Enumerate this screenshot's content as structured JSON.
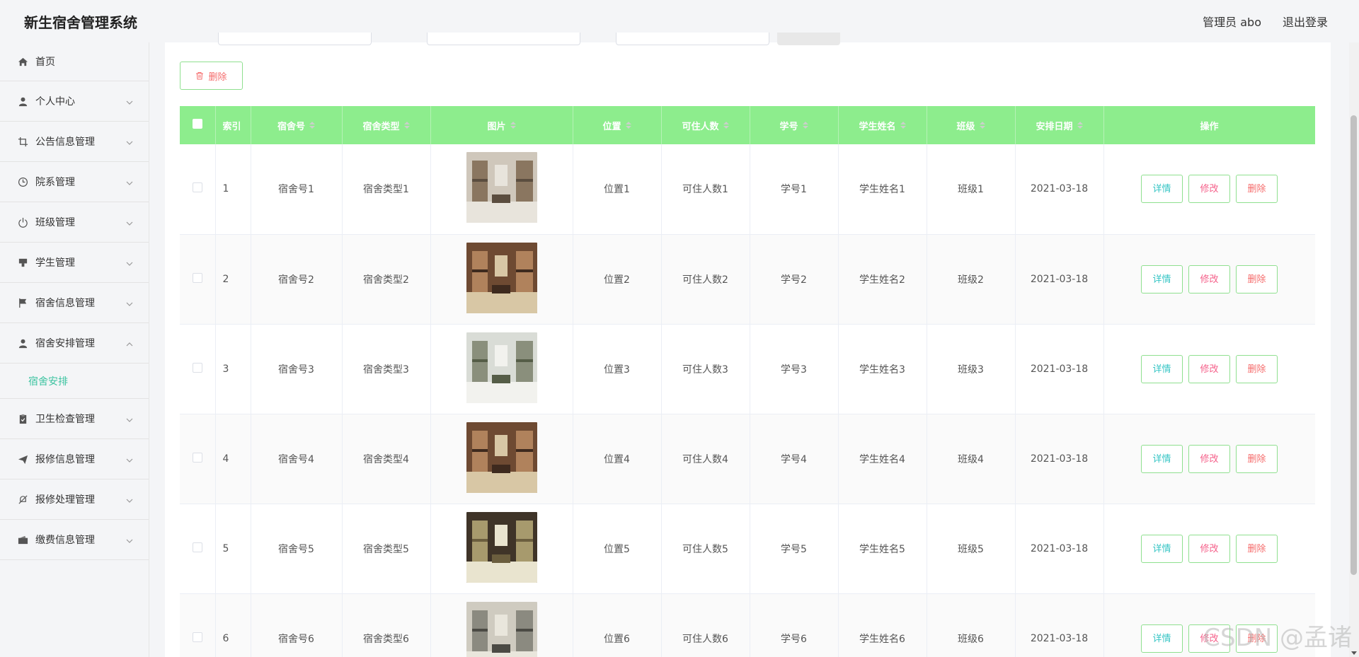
{
  "header": {
    "title": "新生宿舍管理系统",
    "user_label": "管理员 abo",
    "logout_label": "退出登录"
  },
  "sidebar": {
    "items": [
      {
        "label": "首页",
        "icon": "home-icon"
      },
      {
        "label": "个人中心",
        "icon": "user-icon"
      },
      {
        "label": "公告信息管理",
        "icon": "crop-icon"
      },
      {
        "label": "院系管理",
        "icon": "clock-icon"
      },
      {
        "label": "班级管理",
        "icon": "power-icon"
      },
      {
        "label": "学生管理",
        "icon": "stamp-icon"
      },
      {
        "label": "宿舍信息管理",
        "icon": "flag-icon"
      },
      {
        "label": "宿舍安排管理",
        "icon": "user-icon",
        "expanded": true
      },
      {
        "label": "卫生检查管理",
        "icon": "clipboard-icon"
      },
      {
        "label": "报修信息管理",
        "icon": "send-icon"
      },
      {
        "label": "报修处理管理",
        "icon": "bell-off-icon"
      },
      {
        "label": "缴费信息管理",
        "icon": "wallet-icon"
      }
    ],
    "sub_item": "宿舍安排"
  },
  "toolbar": {
    "delete_label": "删除"
  },
  "table": {
    "columns": [
      "索引",
      "宿舍号",
      "宿舍类型",
      "图片",
      "位置",
      "可住人数",
      "学号",
      "学生姓名",
      "班级",
      "安排日期",
      "操作"
    ],
    "rows": [
      {
        "index": "1",
        "room": "宿舍号1",
        "type": "宿舍类型1",
        "location": "位置1",
        "capacity": "可住人数1",
        "student_id": "学号1",
        "name": "学生姓名1",
        "class": "班级1",
        "date": "2021-03-18"
      },
      {
        "index": "2",
        "room": "宿舍号2",
        "type": "宿舍类型2",
        "location": "位置2",
        "capacity": "可住人数2",
        "student_id": "学号2",
        "name": "学生姓名2",
        "class": "班级2",
        "date": "2021-03-18"
      },
      {
        "index": "3",
        "room": "宿舍号3",
        "type": "宿舍类型3",
        "location": "位置3",
        "capacity": "可住人数3",
        "student_id": "学号3",
        "name": "学生姓名3",
        "class": "班级3",
        "date": "2021-03-18"
      },
      {
        "index": "4",
        "room": "宿舍号4",
        "type": "宿舍类型4",
        "location": "位置4",
        "capacity": "可住人数4",
        "student_id": "学号4",
        "name": "学生姓名4",
        "class": "班级4",
        "date": "2021-03-18"
      },
      {
        "index": "5",
        "room": "宿舍号5",
        "type": "宿舍类型5",
        "location": "位置5",
        "capacity": "可住人数5",
        "student_id": "学号5",
        "name": "学生姓名5",
        "class": "班级5",
        "date": "2021-03-18"
      },
      {
        "index": "6",
        "room": "宿舍号6",
        "type": "宿舍类型6",
        "location": "位置6",
        "capacity": "可住人数6",
        "student_id": "学号6",
        "name": "学生姓名6",
        "class": "班级6",
        "date": "2021-03-18"
      }
    ],
    "actions": {
      "detail": "详情",
      "edit": "修改",
      "delete": "删除"
    }
  },
  "watermark": "CSDN @孟诸",
  "colors": {
    "header_bg": "#8ded8d",
    "accent": "#3cc3a0",
    "button_border": "#8fe08f",
    "danger": "#f56c6c"
  }
}
